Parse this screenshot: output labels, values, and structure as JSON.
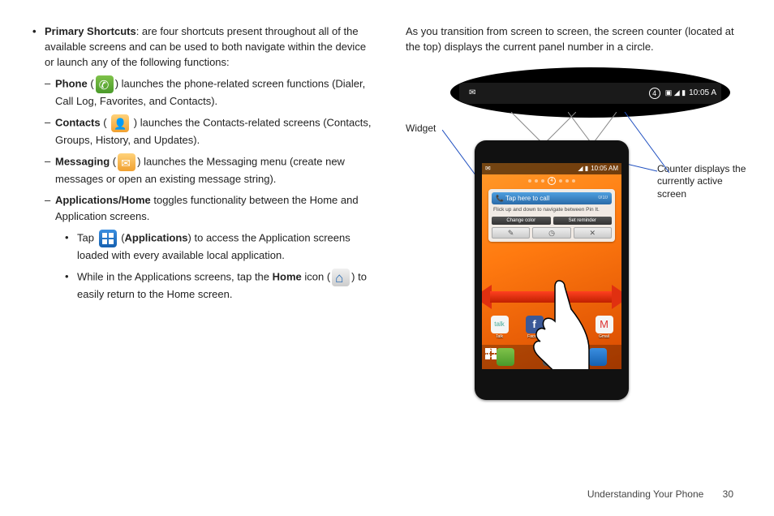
{
  "left_column": {
    "primary_shortcuts_label": "Primary Shortcuts",
    "primary_shortcuts_text": ": are four shortcuts present throughout all of the available screens and can be used to both navigate within the device or launch any of the following functions:",
    "phone": {
      "label": "Phone",
      "pre": " (",
      "post": ") launches the phone-related screen functions (Dialer, Call Log, Favorites, and Contacts)."
    },
    "contacts": {
      "label": "Contacts",
      "pre": " ( ",
      "post": " ) launches the Contacts-related screens (Contacts, Groups, History, and Updates)."
    },
    "messaging": {
      "label": "Messaging",
      "pre": " (",
      "post": ") launches the Messaging menu (create new messages or open an existing message string)."
    },
    "apps_home": {
      "label": "Applications/Home",
      "text": " toggles functionality between the Home and Application screens."
    },
    "tap_apps": {
      "pre": "Tap ",
      "bold": "Applications",
      "post_open": " (",
      "post": ") to access the Application screens loaded with every available local application."
    },
    "tap_home": {
      "pre": "While in the Applications screens, tap the ",
      "bold": "Home",
      "mid": " icon (",
      "post": ") to easily return to the Home screen."
    }
  },
  "right_column": {
    "intro": "As you transition from screen to screen, the screen counter (located at the top) displays the current panel number in a circle.",
    "label_widget": "Widget",
    "label_counter": "Counter displays the currently active screen",
    "top_status": {
      "icons": "▣ ◢ ▮",
      "time": "10:05 A",
      "counter": "4"
    },
    "phone_screen": {
      "status_time": "10:05 AM",
      "counter_active": "4",
      "tap_to_call": "Tap here to call",
      "tap_count": "0/10",
      "flick_text": "Flick up and down to navigate between Pin It.",
      "btn_change": "Change color",
      "btn_reminder": "Set reminder",
      "row2": {
        "edit": "✎",
        "clock": "◷",
        "close": "✕"
      },
      "apps": [
        {
          "name": "Talk",
          "color": "#f5f5f5"
        },
        {
          "name": "Facebo",
          "color": "#3b5998"
        },
        {
          "name": "",
          "color": "#333"
        },
        {
          "name": "Gmail",
          "color": "#f5f5f5"
        }
      ]
    }
  },
  "footer": {
    "section": "Understanding Your Phone",
    "page": "30"
  }
}
